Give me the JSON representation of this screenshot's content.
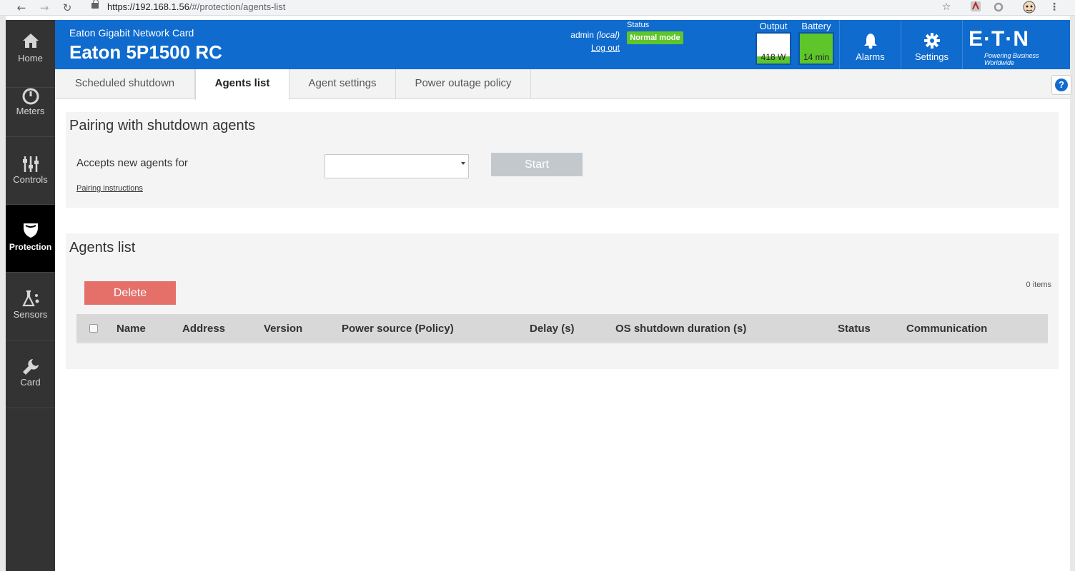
{
  "browser": {
    "url_host": "https://192.168.1.56",
    "url_path": "/#/protection/agents-list",
    "icons": [
      "back-arrow-icon",
      "forward-arrow-icon",
      "reload-icon",
      "lock-icon",
      "star-icon",
      "pdf-extension-icon",
      "circle-extension-icon",
      "profile-avatar-icon",
      "menu-dots-icon"
    ]
  },
  "header": {
    "brand_sub": "Eaton Gigabit Network Card",
    "brand_title": "Eaton 5P1500 RC",
    "user": "admin",
    "user_loc": "(local)",
    "logout": "Log out",
    "status_label": "Status",
    "status_value": "Normal mode",
    "output_label": "Output",
    "output_value": "418 W",
    "output_fill_fraction": 0.25,
    "battery_label": "Battery",
    "battery_value": "14 min",
    "battery_fill_fraction": 1.0,
    "alarms_label": "Alarms",
    "settings_label": "Settings",
    "logo": "E·T·N",
    "tagline": "Powering Business Worldwide",
    "accent_color": "#0f6bce",
    "status_color": "#5ec52a"
  },
  "sidebar": {
    "items": [
      {
        "label": "Home",
        "icon": "home-icon"
      },
      {
        "label": "Meters",
        "icon": "gauge-icon"
      },
      {
        "label": "Controls",
        "icon": "sliders-icon"
      },
      {
        "label": "Protection",
        "icon": "shield-icon"
      },
      {
        "label": "Sensors",
        "icon": "flask-icon"
      },
      {
        "label": "Card",
        "icon": "wrench-icon"
      }
    ],
    "active": "Protection"
  },
  "tabs": {
    "items": [
      "Scheduled shutdown",
      "Agents list",
      "Agent settings",
      "Power outage policy"
    ],
    "active": "Agents list"
  },
  "pairing": {
    "title": "Pairing with shutdown agents",
    "accepts_label": "Accepts new agents for",
    "select_value": "",
    "start_label": "Start",
    "instructions_link": "Pairing instructions"
  },
  "agents": {
    "title": "Agents list",
    "delete_label": "Delete",
    "items_count": "0 items",
    "columns": [
      "Name",
      "Address",
      "Version",
      "Power source (Policy)",
      "Delay (s)",
      "OS shutdown duration (s)",
      "Status",
      "Communication"
    ],
    "rows": []
  }
}
